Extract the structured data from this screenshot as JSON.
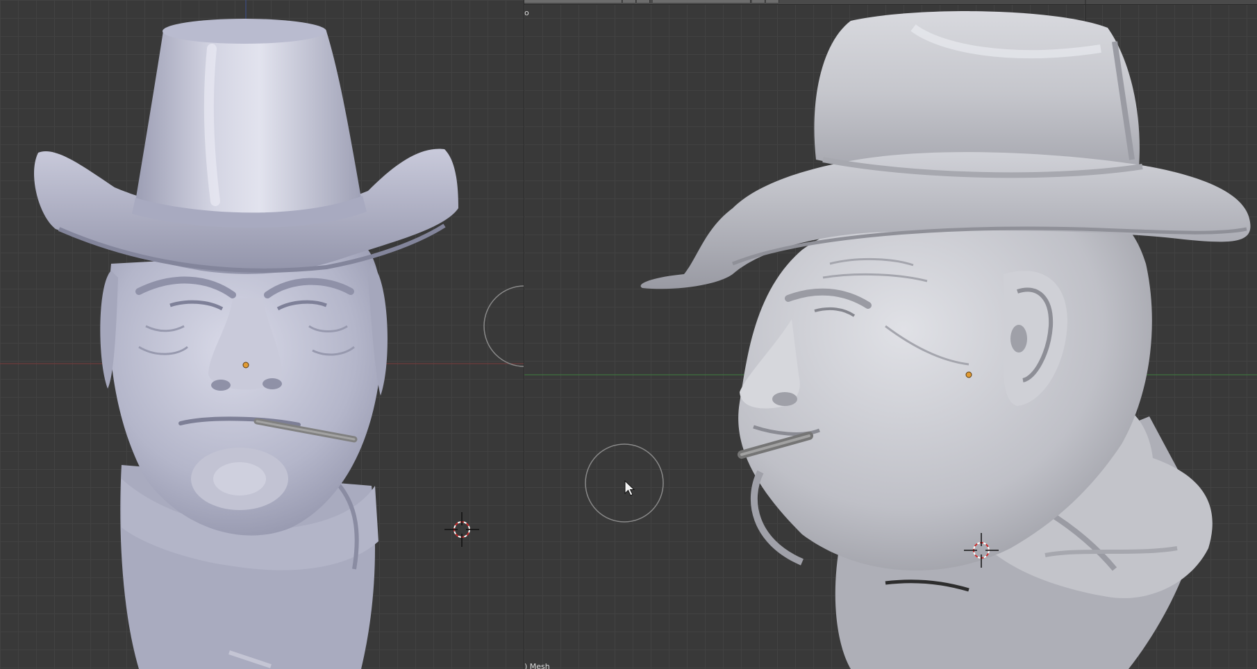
{
  "viewports": {
    "left": {
      "name": "front-view"
    },
    "right": {
      "name": "side-view",
      "header_fragment": "o",
      "object_label": ") Mesh"
    }
  },
  "colors": {
    "background": "#393939",
    "grid": "#424242",
    "mesh_front": "#bbbdd0",
    "mesh_side": "#c8c9ce",
    "axis_x": "#7a3a3a",
    "axis_y": "#3f7f3f",
    "origin_dot": "#e09a32",
    "cursor_ring": "#cc2d2d"
  },
  "icons": [
    "3d-cursor-icon",
    "mouse-pointer-icon",
    "origin-dot-icon"
  ]
}
